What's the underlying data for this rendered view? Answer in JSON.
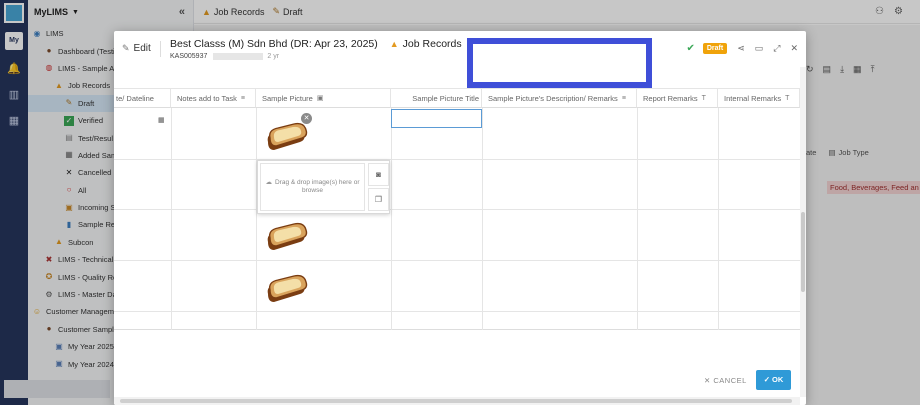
{
  "app": {
    "name": "MyLIMS",
    "rail_badge": "My"
  },
  "topbar": {
    "crumbs": [
      "Job Records",
      "Draft"
    ]
  },
  "sidebar": {
    "items": [
      {
        "label": "LIMS",
        "icon": "globe-icon"
      },
      {
        "label": "Dashboard (Testi",
        "icon": "person-icon"
      },
      {
        "label": "LIMS - Sample Ac",
        "icon": "flask-icon"
      },
      {
        "label": "Job Records",
        "icon": "triangle-icon"
      },
      {
        "label": "Draft",
        "icon": "draft-icon"
      },
      {
        "label": "Verified",
        "icon": "check-icon"
      },
      {
        "label": "Test/Resul",
        "icon": "doc-icon"
      },
      {
        "label": "Added Sam",
        "icon": "grid-icon"
      },
      {
        "label": "Cancelled",
        "icon": "x-icon"
      },
      {
        "label": "All",
        "icon": "circle-icon"
      },
      {
        "label": "Incoming S",
        "icon": "clipboard-icon"
      },
      {
        "label": "Sample Re",
        "icon": "book-icon"
      },
      {
        "label": "Subcon",
        "icon": "triangle-icon"
      },
      {
        "label": "LIMS - Technical",
        "icon": "tools-icon"
      },
      {
        "label": "LIMS - Quality Re",
        "icon": "award-icon"
      },
      {
        "label": "LIMS - Master Da",
        "icon": "gear-icon"
      },
      {
        "label": "Customer Managem",
        "icon": "smile-icon"
      },
      {
        "label": "Customer Sample",
        "icon": "person-icon"
      },
      {
        "label": "My Year 2025",
        "icon": "image-icon"
      },
      {
        "label": "My Year 2024",
        "icon": "image-icon"
      }
    ]
  },
  "modal": {
    "edit_label": "Edit",
    "title": "Best Classs (M) Sdn Bhd (DR: Apr 23, 2025)",
    "module": "Job Records",
    "job_code": "KAS005937",
    "ago": "2 yr",
    "status": "Draft",
    "cancel": "✕ CANCEL",
    "ok": "✓ OK"
  },
  "grid": {
    "columns": [
      "te/ Dateline",
      "Notes add to Task",
      "Sample Picture",
      "Sample Picture Title",
      "Sample Picture's Description/ Remarks",
      "Report Remarks",
      "Internal Remarks"
    ]
  },
  "upload": {
    "text": "Drag & drop image(s) here or browse"
  },
  "background": {
    "job_type": "Job Type",
    "date_label": "ate",
    "tag": "Food, Beverages, Feed an"
  }
}
